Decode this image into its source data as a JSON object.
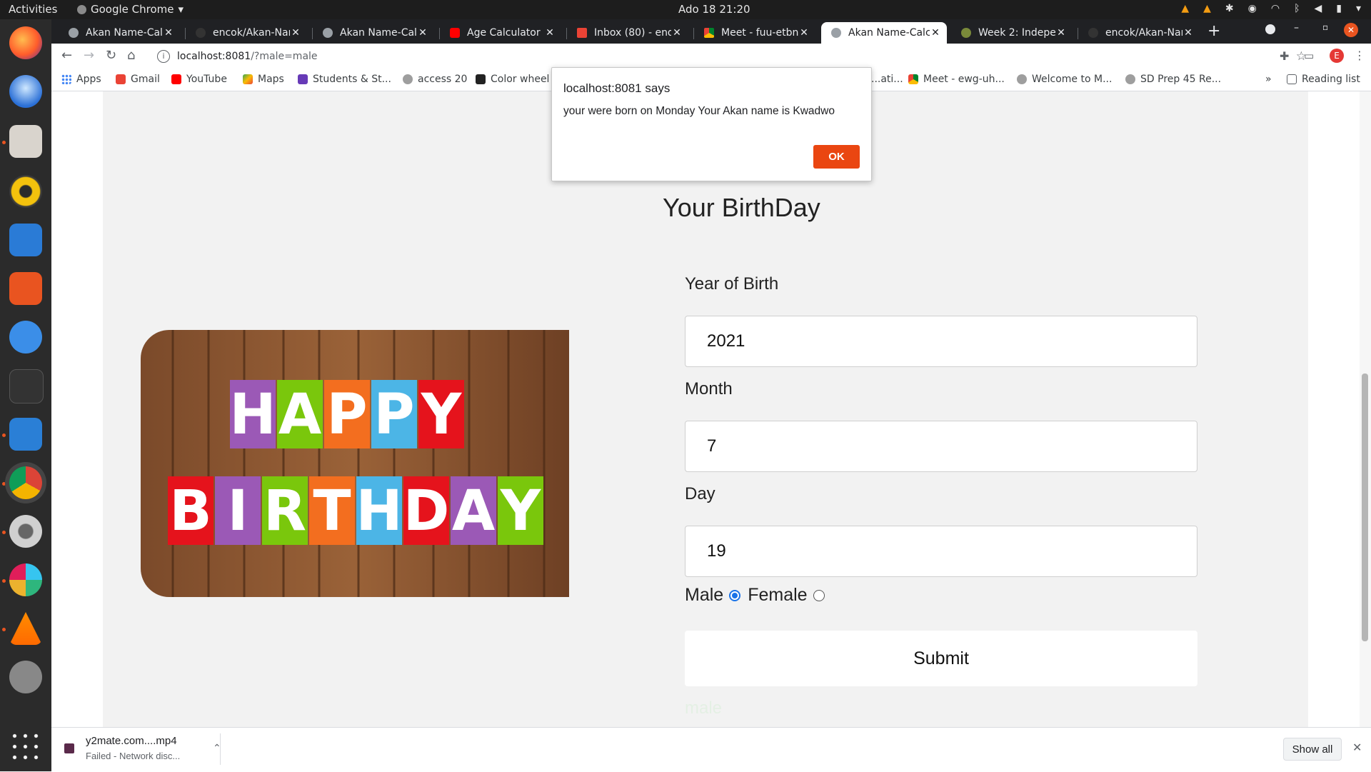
{
  "os": {
    "activities": "Activities",
    "app_name": "Google Chrome",
    "clock": "Ado 18  21:20"
  },
  "browser": {
    "tabs": [
      {
        "label": "Akan Name-Calc",
        "active": false
      },
      {
        "label": "encok/Akan-Nam",
        "active": false
      },
      {
        "label": "Akan Name-Calc",
        "active": false
      },
      {
        "label": "Age Calculator |",
        "active": false
      },
      {
        "label": "Inbox (80) - enoc",
        "active": false
      },
      {
        "label": "Meet - fuu-etbn-",
        "active": false
      },
      {
        "label": "Akan Name-Calc",
        "active": true
      },
      {
        "label": "Week 2: Indepen",
        "active": false
      },
      {
        "label": "encok/Akan-Nam",
        "active": false
      }
    ],
    "url_host": "localhost:8081",
    "url_path": "/?male=male",
    "bookmarks": [
      {
        "label": "Apps"
      },
      {
        "label": "Gmail"
      },
      {
        "label": "YouTube"
      },
      {
        "label": "Maps"
      },
      {
        "label": "Students & St..."
      },
      {
        "label": "access 20"
      },
      {
        "label": "Color wheel"
      },
      {
        "label": "...ati..."
      },
      {
        "label": "Meet - ewg-uh..."
      },
      {
        "label": "Welcome to M..."
      },
      {
        "label": "SD Prep 45 Re..."
      }
    ],
    "reading_list": "Reading list"
  },
  "alert": {
    "title": "localhost:8081 says",
    "message": "your were born on Monday Your Akan name is Kwadwo",
    "ok_label": "OK"
  },
  "page": {
    "heading": "Your BirthDay",
    "image_line1": "HAPPY",
    "image_line2": "BIRTHDAY",
    "year_label": "Year of Birth",
    "year_value": "2021",
    "month_label": "Month",
    "month_value": "7",
    "day_label": "Day",
    "day_value": "19",
    "gender_male": "Male",
    "gender_female": "Female",
    "gender_selected": "Male",
    "submit_label": "Submit",
    "result_text": "male"
  },
  "downloads": {
    "file": "y2mate.com....mp4",
    "status": "Failed - Network disc...",
    "show_all": "Show all"
  },
  "colors": {
    "alert_ok": "#ea4611",
    "radio_checked": "#1a73e8",
    "letter_colors": [
      "#9b59b6",
      "#7ac70c",
      "#f36e1f",
      "#4cb5e6",
      "#e5131c"
    ]
  }
}
